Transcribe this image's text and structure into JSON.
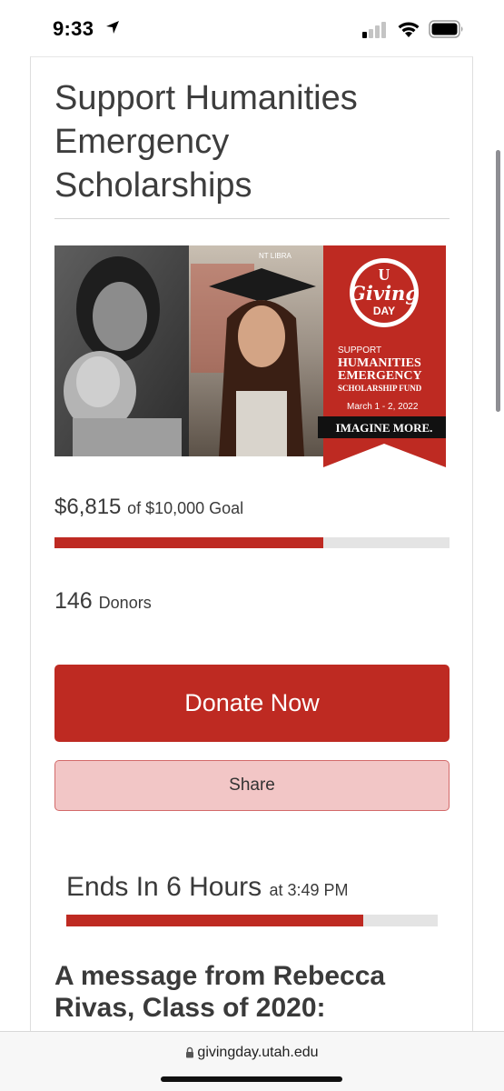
{
  "status_bar": {
    "time": "9:33",
    "icons": [
      "location-arrow-icon",
      "signal-icon",
      "wifi-icon",
      "battery-icon"
    ]
  },
  "campaign": {
    "title": "Support Humanities Emergency Scholarships",
    "banner": {
      "logo_letter": "U",
      "logo_line1": "Giving",
      "logo_line2": "DAY",
      "text_support": "SUPPORT",
      "text_humanities": "HUMANITIES",
      "text_emergency": "EMERGENCY",
      "text_fund": "SCHOLARSHIP FUND",
      "dates": "March 1 - 2, 2022",
      "tagline": "IMAGINE MORE.",
      "sign_text": "NT LIBRA"
    },
    "raised_amount": "$6,815",
    "goal_text": "of $10,000 Goal",
    "progress_fraction": 0.6815,
    "donor_count": "146",
    "donors_label": "Donors"
  },
  "actions": {
    "donate_label": "Donate Now",
    "share_label": "Share"
  },
  "countdown": {
    "ends_text": "Ends In 6 Hours",
    "at_text": "at 3:49 PM",
    "elapsed_fraction": 0.8
  },
  "message_heading": "A message from Rebecca Rivas, Class of 2020:",
  "browser": {
    "url": "givingday.utah.edu"
  },
  "colors": {
    "utah_red": "#be2a22",
    "share_bg": "#f2c6c6",
    "track": "#e4e4e4"
  }
}
